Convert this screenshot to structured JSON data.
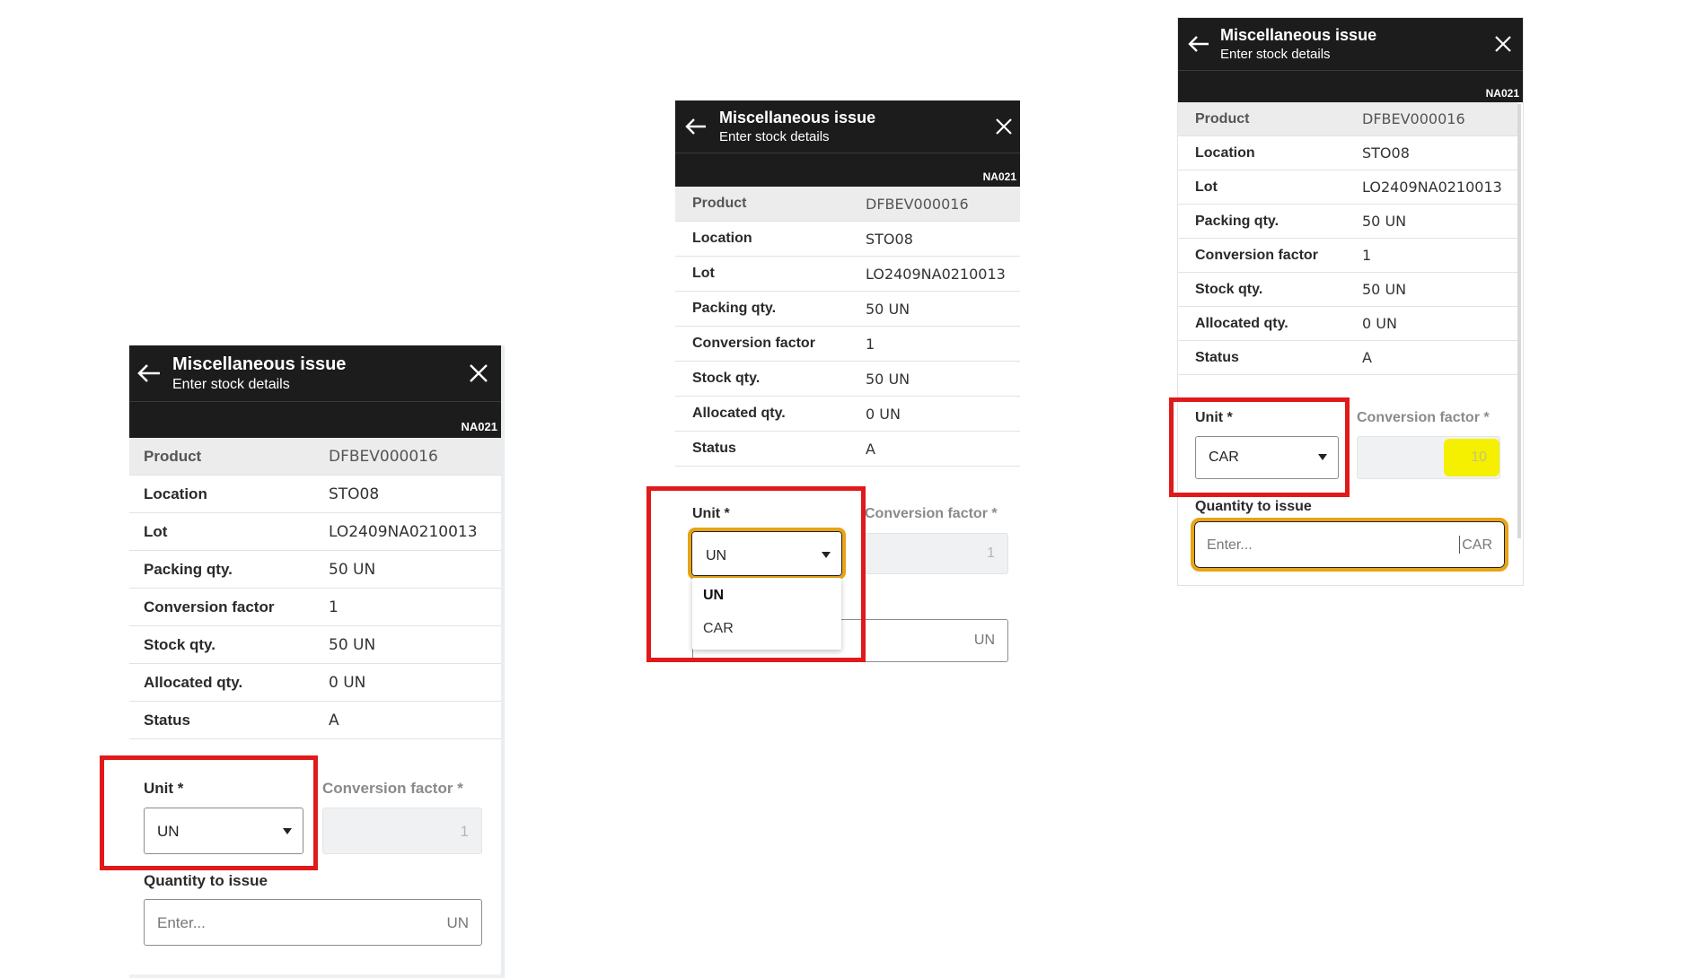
{
  "colors": {
    "header_bg": "#1c1c1c",
    "highlight_red": "#e01a1a",
    "focus_border": "#e8a317",
    "marker_yellow": "#f5f000"
  },
  "header": {
    "title": "Miscellaneous issue",
    "subtitle": "Enter stock details",
    "site": "NA021",
    "back_icon": "arrow-left-icon",
    "close_icon": "close-icon"
  },
  "details": [
    {
      "label": "Product",
      "value": "DFBEV000016"
    },
    {
      "label": "Location",
      "value": "STO08"
    },
    {
      "label": "Lot",
      "value": "LO2409NA0210013"
    },
    {
      "label": "Packing qty.",
      "value": "50 UN"
    },
    {
      "label": "Conversion factor",
      "value": "1"
    },
    {
      "label": "Stock qty.",
      "value": "50 UN"
    },
    {
      "label": "Allocated qty.",
      "value": "0 UN"
    },
    {
      "label": "Status",
      "value": "A"
    }
  ],
  "form": {
    "unit_label": "Unit *",
    "conversion_label": "Conversion factor *",
    "quantity_label": "Quantity to issue",
    "quantity_placeholder": "Enter..."
  },
  "panel1": {
    "unit_value": "UN",
    "conversion_value": "1",
    "qty_unit": "UN"
  },
  "panel2": {
    "unit_value": "UN",
    "conversion_value": "1",
    "qty_unit": "UN",
    "options": [
      "UN",
      "CAR"
    ],
    "selected_option": "UN"
  },
  "panel3": {
    "unit_value": "CAR",
    "conversion_value": "10",
    "qty_unit": "CAR"
  }
}
